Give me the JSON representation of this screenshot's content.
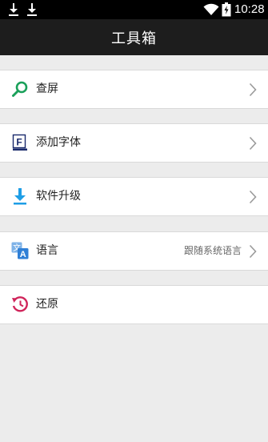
{
  "status_bar": {
    "time": "10:28",
    "icons": [
      "download-icon",
      "download-icon",
      "wifi-icon",
      "battery-icon"
    ]
  },
  "header": {
    "title": "工具箱"
  },
  "menu": {
    "items": [
      {
        "label": "查屏",
        "icon": "search-icon",
        "value": ""
      },
      {
        "label": "添加字体",
        "icon": "font-icon",
        "value": ""
      },
      {
        "label": "软件升级",
        "icon": "download-arrow-icon",
        "value": ""
      },
      {
        "label": "语言",
        "icon": "translate-icon",
        "value": "跟随系统语言"
      },
      {
        "label": "还原",
        "icon": "restore-icon",
        "value": ""
      }
    ]
  },
  "colors": {
    "status_bar_bg": "#000000",
    "title_bar_bg": "#1d1d1d",
    "page_bg": "#ececec",
    "search_icon": "#1aa05a",
    "download_icon": "#1e9ee6",
    "translate_icon": "#2f7fd6",
    "restore_icon": "#d0245a"
  }
}
